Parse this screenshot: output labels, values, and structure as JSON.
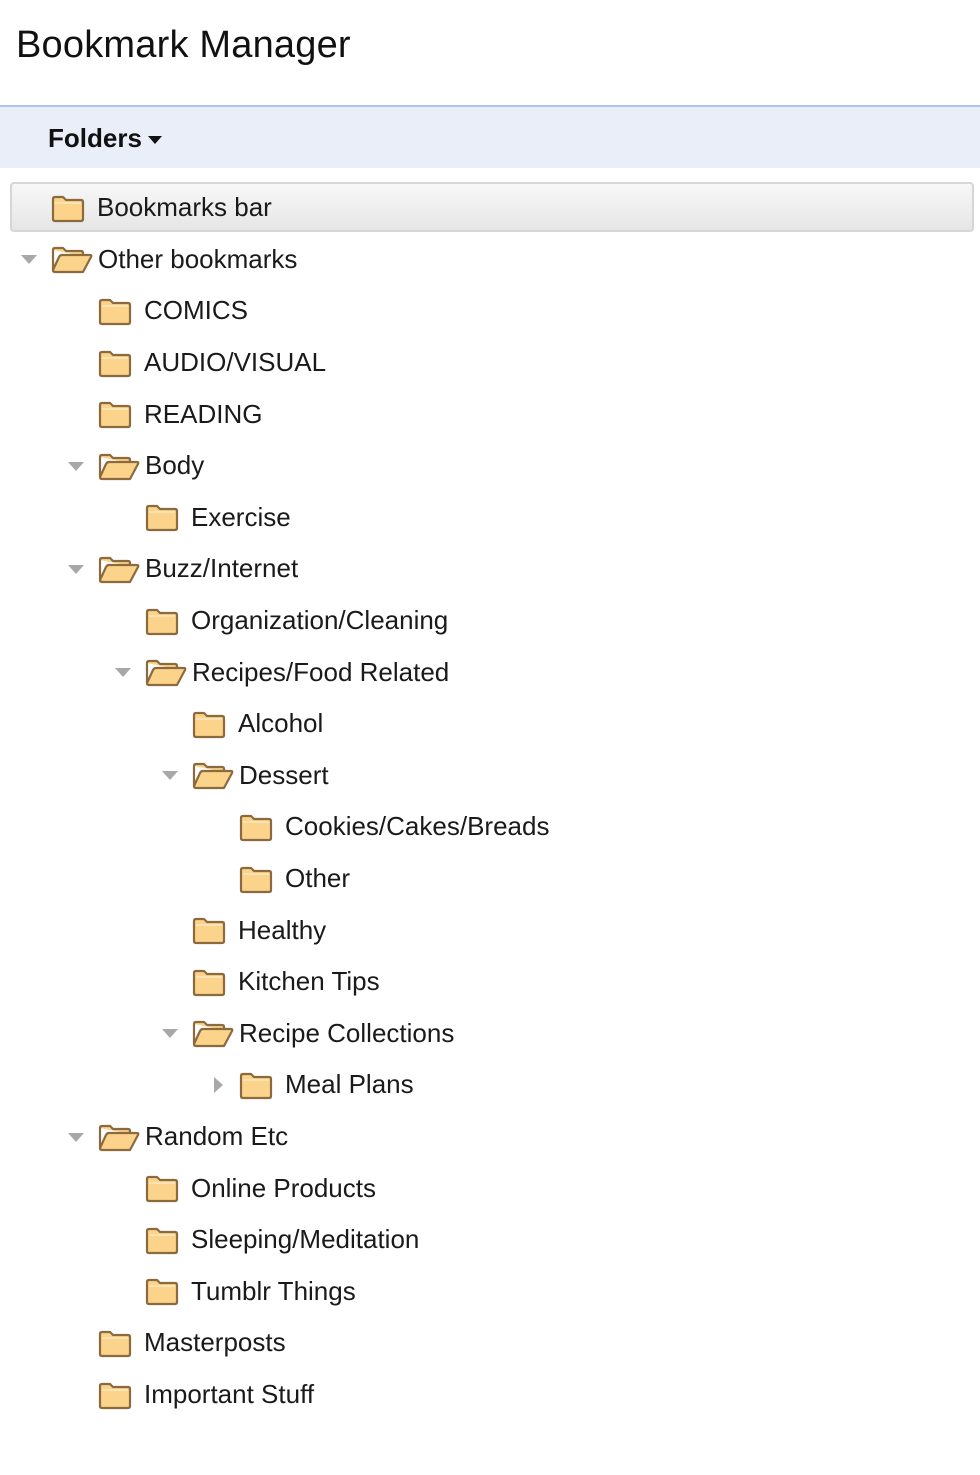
{
  "app": {
    "title": "Bookmark Manager"
  },
  "toolbar": {
    "folders_label": "Folders"
  },
  "colors": {
    "toolbar_bg": "#e9eef9",
    "toolbar_border": "#a9c6ef",
    "folder_fill": "#fcd38a",
    "folder_outline": "#8a6a3e",
    "expander": "#a8a8a8"
  },
  "tree": [
    {
      "label": "Bookmarks bar",
      "depth": 0,
      "expander": "none",
      "open": false,
      "selected": true
    },
    {
      "label": "Other bookmarks",
      "depth": 0,
      "expander": "open",
      "open": true,
      "selected": false
    },
    {
      "label": "COMICS",
      "depth": 1,
      "expander": "none",
      "open": false,
      "selected": false
    },
    {
      "label": "AUDIO/VISUAL",
      "depth": 1,
      "expander": "none",
      "open": false,
      "selected": false
    },
    {
      "label": "READING",
      "depth": 1,
      "expander": "none",
      "open": false,
      "selected": false
    },
    {
      "label": "Body",
      "depth": 1,
      "expander": "open",
      "open": true,
      "selected": false
    },
    {
      "label": "Exercise",
      "depth": 2,
      "expander": "none",
      "open": false,
      "selected": false
    },
    {
      "label": "Buzz/Internet",
      "depth": 1,
      "expander": "open",
      "open": true,
      "selected": false
    },
    {
      "label": "Organization/Cleaning",
      "depth": 2,
      "expander": "none",
      "open": false,
      "selected": false
    },
    {
      "label": "Recipes/Food Related",
      "depth": 2,
      "expander": "open",
      "open": true,
      "selected": false
    },
    {
      "label": "Alcohol",
      "depth": 3,
      "expander": "none",
      "open": false,
      "selected": false
    },
    {
      "label": "Dessert",
      "depth": 3,
      "expander": "open",
      "open": true,
      "selected": false
    },
    {
      "label": "Cookies/Cakes/Breads",
      "depth": 4,
      "expander": "none",
      "open": false,
      "selected": false
    },
    {
      "label": "Other",
      "depth": 4,
      "expander": "none",
      "open": false,
      "selected": false
    },
    {
      "label": "Healthy",
      "depth": 3,
      "expander": "none",
      "open": false,
      "selected": false
    },
    {
      "label": "Kitchen Tips",
      "depth": 3,
      "expander": "none",
      "open": false,
      "selected": false
    },
    {
      "label": "Recipe Collections",
      "depth": 3,
      "expander": "open",
      "open": true,
      "selected": false
    },
    {
      "label": "Meal Plans",
      "depth": 4,
      "expander": "closed",
      "open": false,
      "selected": false
    },
    {
      "label": "Random Etc",
      "depth": 1,
      "expander": "open",
      "open": true,
      "selected": false
    },
    {
      "label": "Online Products",
      "depth": 2,
      "expander": "none",
      "open": false,
      "selected": false
    },
    {
      "label": "Sleeping/Meditation",
      "depth": 2,
      "expander": "none",
      "open": false,
      "selected": false
    },
    {
      "label": "Tumblr Things",
      "depth": 2,
      "expander": "none",
      "open": false,
      "selected": false
    },
    {
      "label": "Masterposts",
      "depth": 1,
      "expander": "none",
      "open": false,
      "selected": false
    },
    {
      "label": "Important Stuff",
      "depth": 1,
      "expander": "none",
      "open": false,
      "selected": false
    }
  ]
}
